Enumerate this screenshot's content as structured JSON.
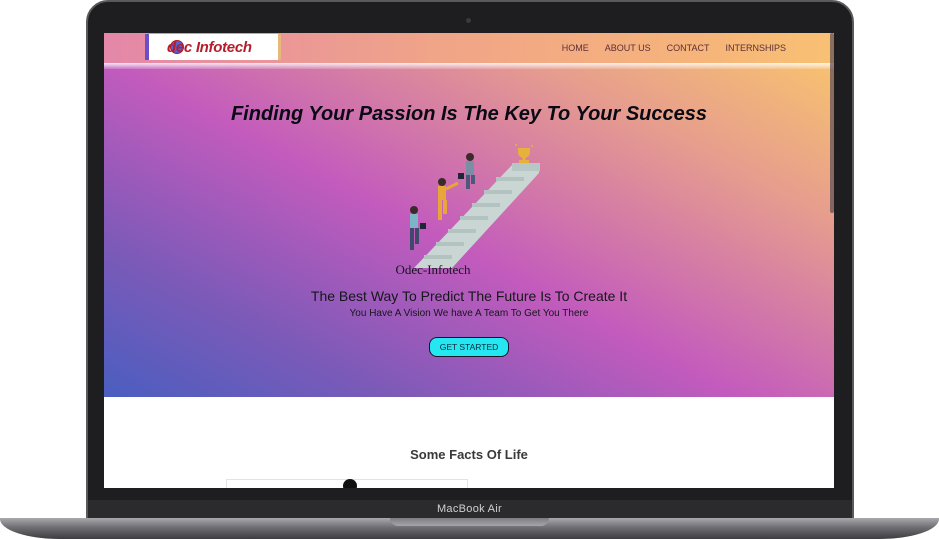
{
  "device": {
    "brand_label": "MacBook Air"
  },
  "website": {
    "logo": {
      "text": "dec Infotech"
    },
    "nav": {
      "items": [
        {
          "label": "HOME"
        },
        {
          "label": "ABOUT US"
        },
        {
          "label": "CONTACT"
        },
        {
          "label": "INTERNSHIPS"
        }
      ]
    },
    "hero": {
      "headline": "Finding Your Passion Is The Key To Your Success",
      "illustration_caption": "Odec-Infotech",
      "tagline": "The Best Way To Predict The Future Is To Create It",
      "subline": "You Have A Vision We have A Team To Get You There",
      "cta_label": "GET STARTED"
    },
    "facts_section": {
      "title": "Some Facts Of Life"
    }
  },
  "colors": {
    "cta": "#25e7f1",
    "logo_text": "#b51d2c",
    "hero_gradient": [
      "#fbc96a",
      "#c35bbd",
      "#4a5ec0"
    ]
  },
  "icons": {
    "logo_mark": "globe-person-icon",
    "illustration": "people-climbing-stairs-to-trophy-illustration"
  }
}
